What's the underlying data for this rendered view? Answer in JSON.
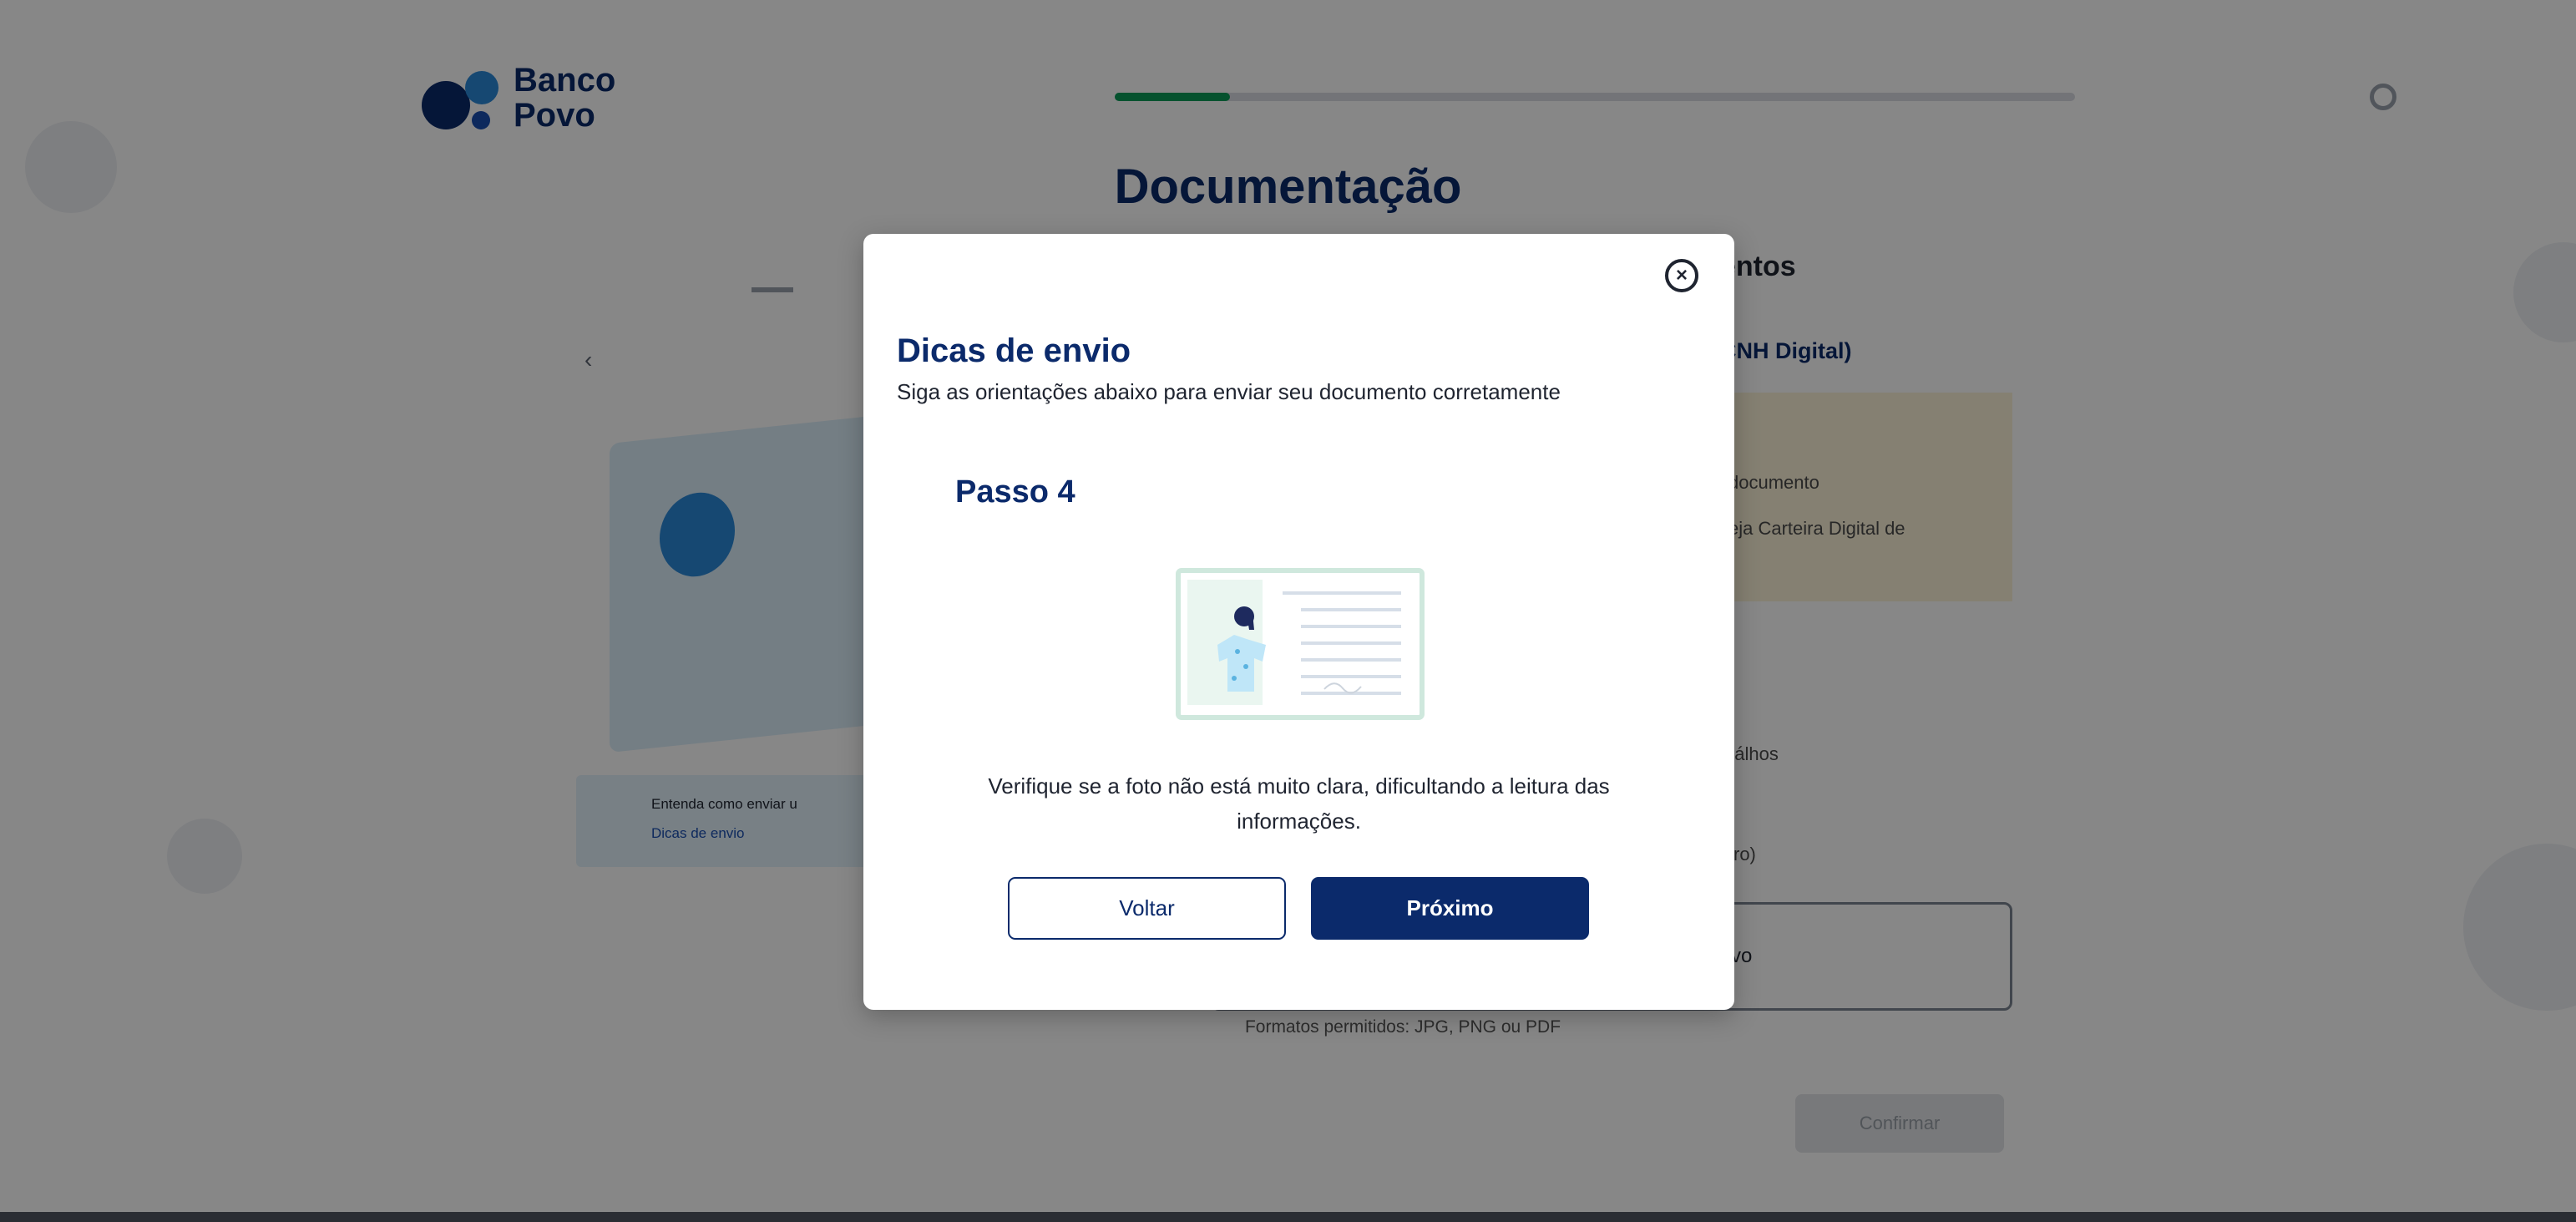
{
  "header": {
    "logo_text": "Banco\nPovo",
    "progress_fraction": 0.12
  },
  "page": {
    "title": "Documentação",
    "partial_texts": {
      "heading_fragment": "entos",
      "link_fragment": "CNH Digital)",
      "note_line1": "documento",
      "note_line2": "eja Carteira Digital de",
      "label1_fragment": "nálhos",
      "label2_fragment": "tiro)",
      "upload_fragment": "vo",
      "formats": "Formatos permitidos: JPG, PNG ou PDF",
      "confirm_label": "Confirmar",
      "info_line1": "Entenda como enviar u",
      "info_line2": "Dicas de envio"
    }
  },
  "modal": {
    "title": "Dicas de envio",
    "subtitle": "Siga as orientações abaixo para enviar seu documento corretamente",
    "step_label": "Passo 4",
    "step_text": "Verifique se a foto não está muito clara, dificultando a leitura das informações.",
    "buttons": {
      "back": "Voltar",
      "next": "Próximo"
    },
    "close_icon": "close-circle-icon"
  },
  "colors": {
    "brand_navy": "#0b2a6b",
    "progress_green": "#0a9b57",
    "illustration_border": "#cfe8dd"
  }
}
